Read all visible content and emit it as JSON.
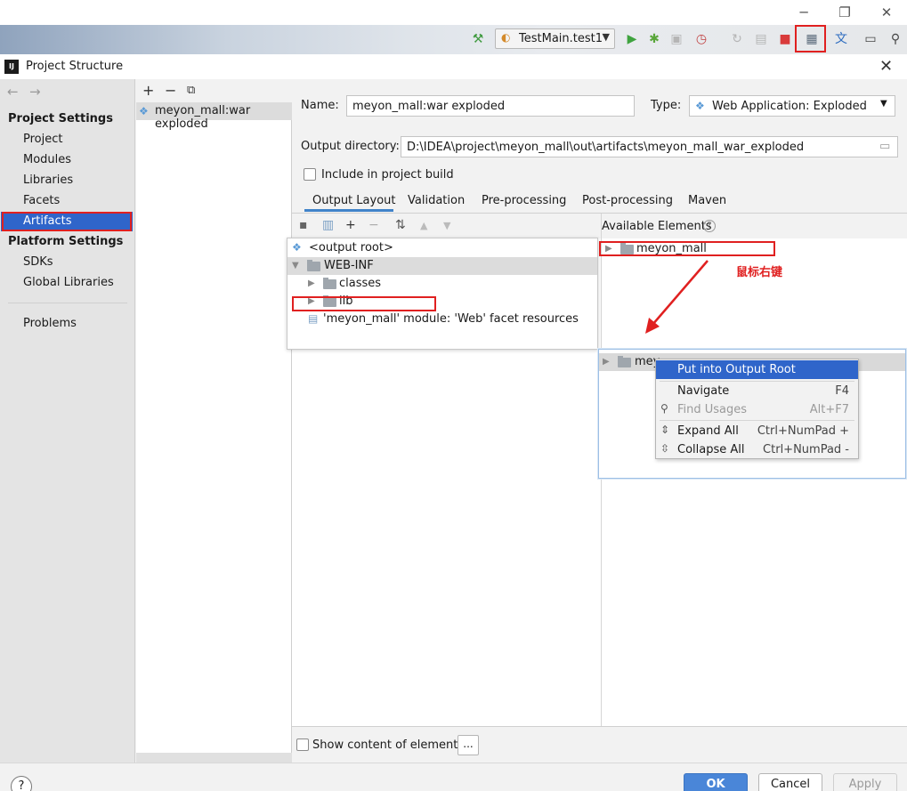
{
  "ide_toolbar": {
    "run_config": "TestMain.test1",
    "window_controls": [
      "─",
      "❐",
      "✕"
    ]
  },
  "dialog": {
    "title": "Project Structure",
    "close": "✕"
  },
  "sidebar": {
    "project_settings_header": "Project Settings",
    "project_items": [
      "Project",
      "Modules",
      "Libraries",
      "Facets",
      "Artifacts"
    ],
    "platform_settings_header": "Platform Settings",
    "platform_items": [
      "SDKs",
      "Global Libraries"
    ],
    "problems": "Problems",
    "selected": "Artifacts"
  },
  "artifacts": {
    "toolbar": [
      "+",
      "−",
      "⧉"
    ],
    "items": [
      "meyon_mall:war exploded"
    ]
  },
  "form": {
    "name_label": "Name:",
    "name_value": "meyon_mall:war exploded",
    "type_label": "Type:",
    "type_value": "Web Application: Exploded",
    "output_dir_label": "Output directory:",
    "output_dir_value": "D:\\IDEA\\project\\meyon_mall\\out\\artifacts\\meyon_mall_war_exploded",
    "include_label": "Include in project build"
  },
  "tabs": [
    "Output Layout",
    "Validation",
    "Pre-processing",
    "Post-processing",
    "Maven"
  ],
  "output_tree": {
    "root": "<output root>",
    "web_inf": "WEB-INF",
    "classes": "classes",
    "lib": "lib",
    "module_resource": "'meyon_mall' module: 'Web' facet resources"
  },
  "available": {
    "label": "Available Elements",
    "item": "meyon_mall",
    "item_partial": "mey"
  },
  "annotation": "鼠标右键",
  "context_menu": {
    "items": [
      {
        "label": "Put into Output Root",
        "shortcut": "",
        "state": "selected",
        "icon": ""
      },
      {
        "label": "Navigate",
        "shortcut": "F4",
        "state": "normal",
        "icon": ""
      },
      {
        "label": "Find Usages",
        "shortcut": "Alt+F7",
        "state": "disabled",
        "icon": "search-icon"
      },
      {
        "label": "Expand All",
        "shortcut": "Ctrl+NumPad +",
        "state": "normal",
        "icon": "expand-all-icon"
      },
      {
        "label": "Collapse All",
        "shortcut": "Ctrl+NumPad -",
        "state": "normal",
        "icon": "collapse-all-icon"
      }
    ]
  },
  "bottom": {
    "show_content_label": "Show content of elements",
    "dots": "..."
  },
  "footer": {
    "help": "?",
    "ok": "OK",
    "cancel": "Cancel",
    "apply": "Apply"
  },
  "colors": {
    "selection": "#2f65ca",
    "annotation_red": "#e02020",
    "ok_button": "#4a86d8"
  }
}
